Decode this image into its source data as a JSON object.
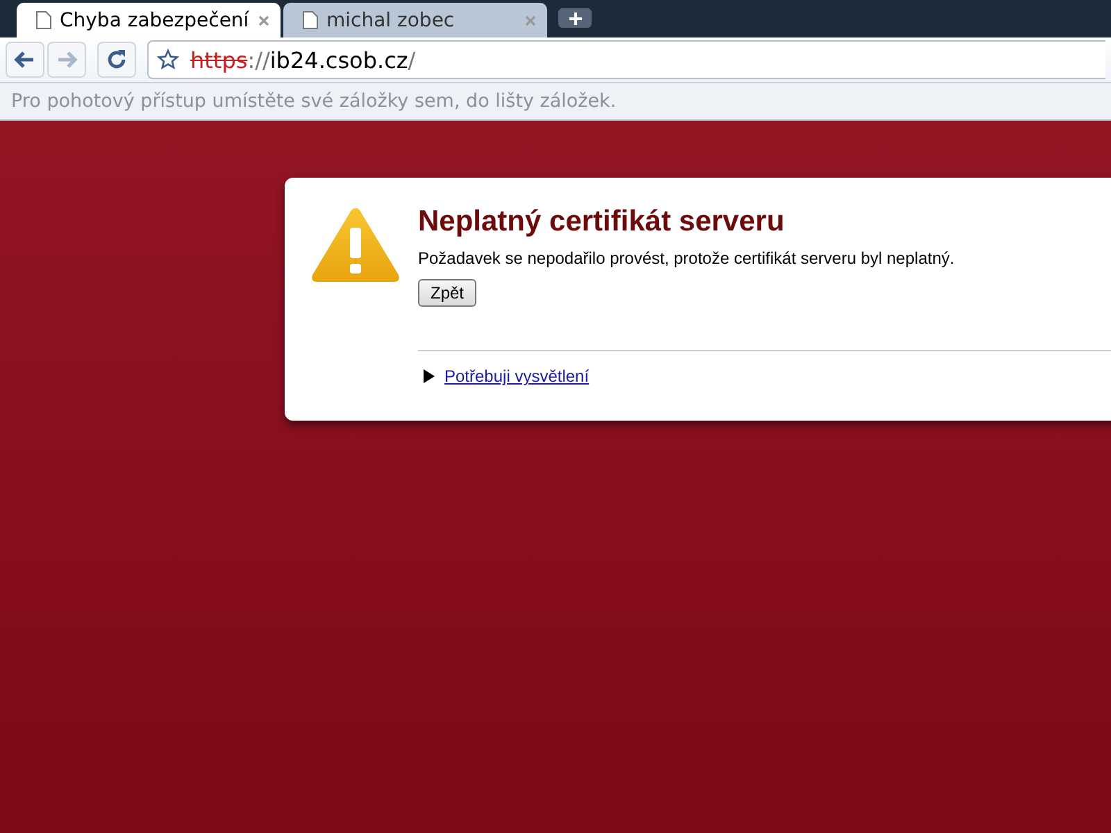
{
  "tabs": [
    {
      "title": "Chyba zabezpečení",
      "selected": true
    },
    {
      "title": "michal zobec",
      "selected": false
    }
  ],
  "address_bar": {
    "scheme": "https",
    "scheme_invalid": true,
    "separator": "://",
    "host": "ib24.csob.cz",
    "path": "/"
  },
  "bookmarks_bar": {
    "hint": "Pro pohotový přístup umístěte své záložky sem, do lišty záložek."
  },
  "error": {
    "title": "Neplatný certifikát serveru",
    "message": "Požadavek se nepodařilo provést, protože certifikát serveru byl neplatný.",
    "back_button": "Zpět",
    "details_link": "Potřebuji vysvětlení",
    "details_expanded": false
  }
}
